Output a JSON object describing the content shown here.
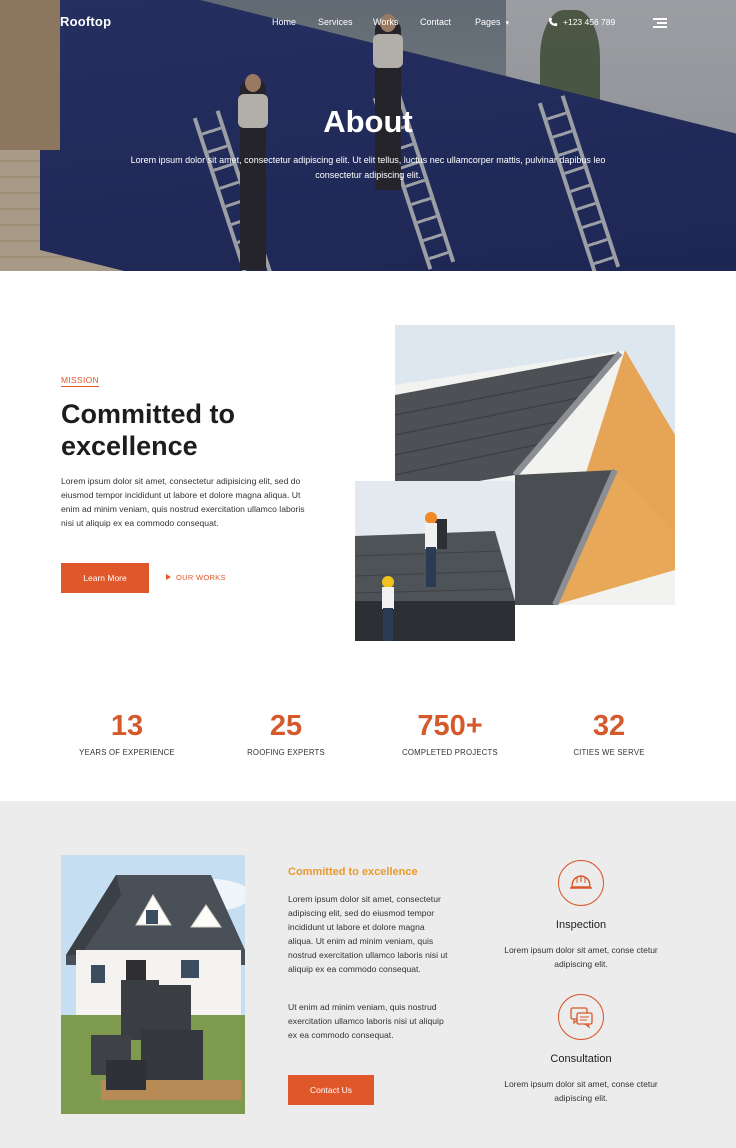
{
  "nav": {
    "logo": "Rooftop",
    "items": [
      {
        "label": "Home"
      },
      {
        "label": "Services"
      },
      {
        "label": "Works"
      },
      {
        "label": "Contact"
      },
      {
        "label": "Pages"
      }
    ],
    "pages_caret": "▾",
    "phone": "+123 456 789"
  },
  "hero": {
    "title": "About",
    "subtitle": "Lorem ipsum dolor sit amet, consectetur adipiscing elit. Ut elit tellus, luctus nec ullamcorper mattis, pulvinar dapibus leo consectetur adipiscing elit."
  },
  "mission": {
    "kicker": "MISSION",
    "title": "Committed to excellence",
    "text": "Lorem ipsum dolor sit amet, consectetur adipisicing elit, sed do eiusmod tempor incididunt ut labore et dolore magna aliqua. Ut enim ad minim veniam, quis nostrud exercitation ullamco laboris nisi ut aliquip ex ea commodo consequat.",
    "learn_more": "Learn More",
    "our_works": "OUR WORKS"
  },
  "stats": [
    {
      "number": "13",
      "label": "YEARS OF EXPERIENCE"
    },
    {
      "number": "25",
      "label": "ROOFING EXPERTS"
    },
    {
      "number": "750+",
      "label": "COMPLETED PROJECTS"
    },
    {
      "number": "32",
      "label": "CITIES WE SERVE"
    }
  ],
  "about": {
    "title": "Committed to excellence",
    "paragraph1": "Lorem ipsum dolor sit amet, consectetur adipiscing elit, sed do eiusmod tempor incididunt ut labore et dolore magna aliqua. Ut enim ad minim veniam, quis nostrud exercitation ullamco laboris nisi ut aliquip ex ea commodo consequat.",
    "paragraph2": "Ut enim ad minim veniam, quis nostrud exercitation ullamco laboris nisi ut aliquip ex ea commodo consequat.",
    "contact_button": "Contact Us"
  },
  "services": [
    {
      "title": "Inspection",
      "text": "Lorem ipsum dolor sit amet, conse ctetur adipiscing elit.",
      "icon": "helmet-icon"
    },
    {
      "title": "Consultation",
      "text": "Lorem ipsum dolor sit amet, conse ctetur adipiscing elit.",
      "icon": "chat-icon"
    }
  ],
  "colors": {
    "accent": "#e0572a",
    "stat_number": "#d45a2c",
    "section_title": "#e89a2d",
    "band_background": "#ececec"
  }
}
